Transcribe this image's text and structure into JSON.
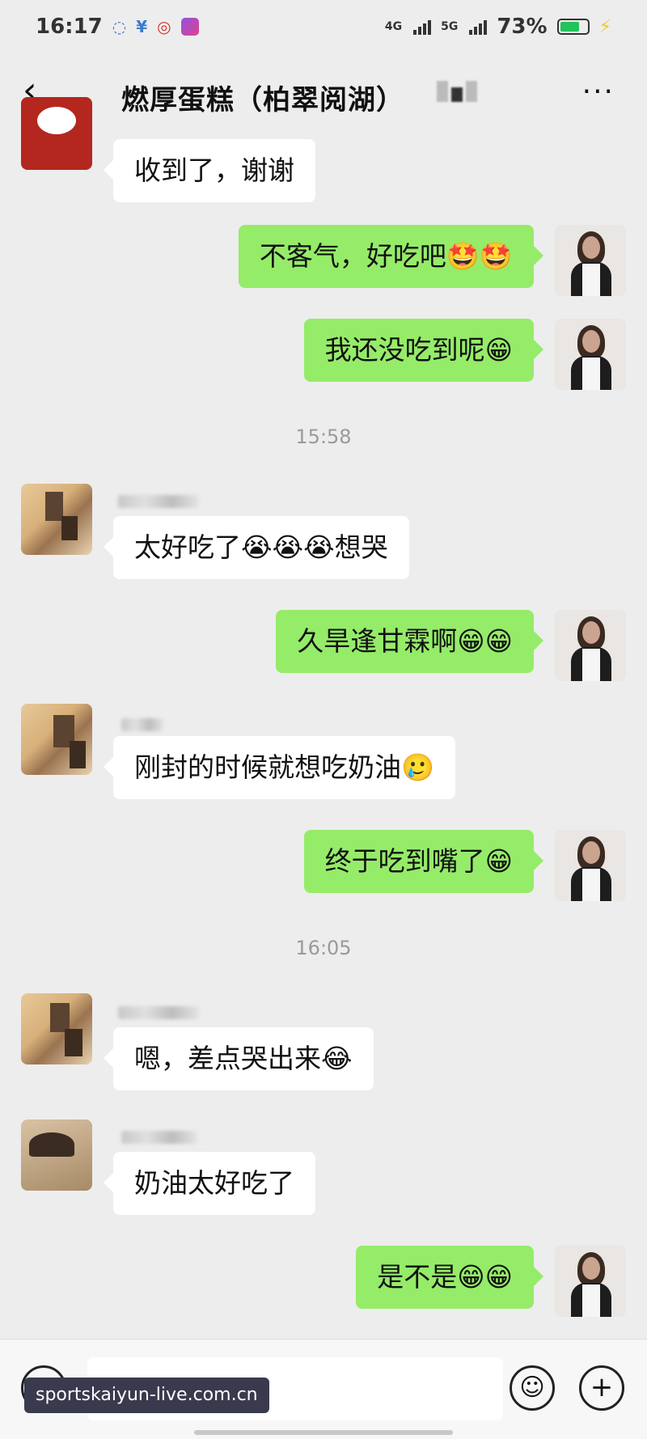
{
  "status_bar": {
    "time": "16:17",
    "net1": "4G",
    "net2": "5G",
    "battery": "73%",
    "battery_level": 0.73,
    "icons": [
      "chat-bubble-icon",
      "yen-icon",
      "bank-icon",
      "app-icon",
      "charging-icon"
    ]
  },
  "header": {
    "back_icon": "‹",
    "title": "燃厚蛋糕（柏翠阅湖）",
    "more_icon": "···"
  },
  "messages": [
    {
      "side": "in",
      "text": "收到了，谢谢",
      "avatar": "red"
    },
    {
      "side": "out",
      "text": "不客气，好吃吧🤩🤩"
    },
    {
      "side": "out",
      "text": "我还没吃到呢😁"
    },
    {
      "side": "in",
      "text": "太好吃了😭😭😭想哭",
      "avatar": "mosaic"
    },
    {
      "side": "out",
      "text": "久旱逢甘霖啊😁😁"
    },
    {
      "side": "in",
      "text": "刚封的时候就想吃奶油🥲",
      "avatar": "mosaic"
    },
    {
      "side": "out",
      "text": "终于吃到嘴了😁"
    },
    {
      "side": "in",
      "text": "嗯，差点哭出来😂",
      "avatar": "mosaic"
    },
    {
      "side": "in",
      "text": "奶油太好吃了",
      "avatar": "photo"
    },
    {
      "side": "out",
      "text": "是不是😁😁"
    }
  ],
  "timestamps": [
    "15:58",
    "16:05"
  ],
  "input_bar": {
    "voice_icon": "◉",
    "emoji_icon": "☺",
    "plus_icon": "+"
  },
  "watermark": "sportskaiyun-live.com.cn",
  "colors": {
    "out_bubble": "#95ec69",
    "in_bubble": "#ffffff",
    "background": "#ededed"
  }
}
